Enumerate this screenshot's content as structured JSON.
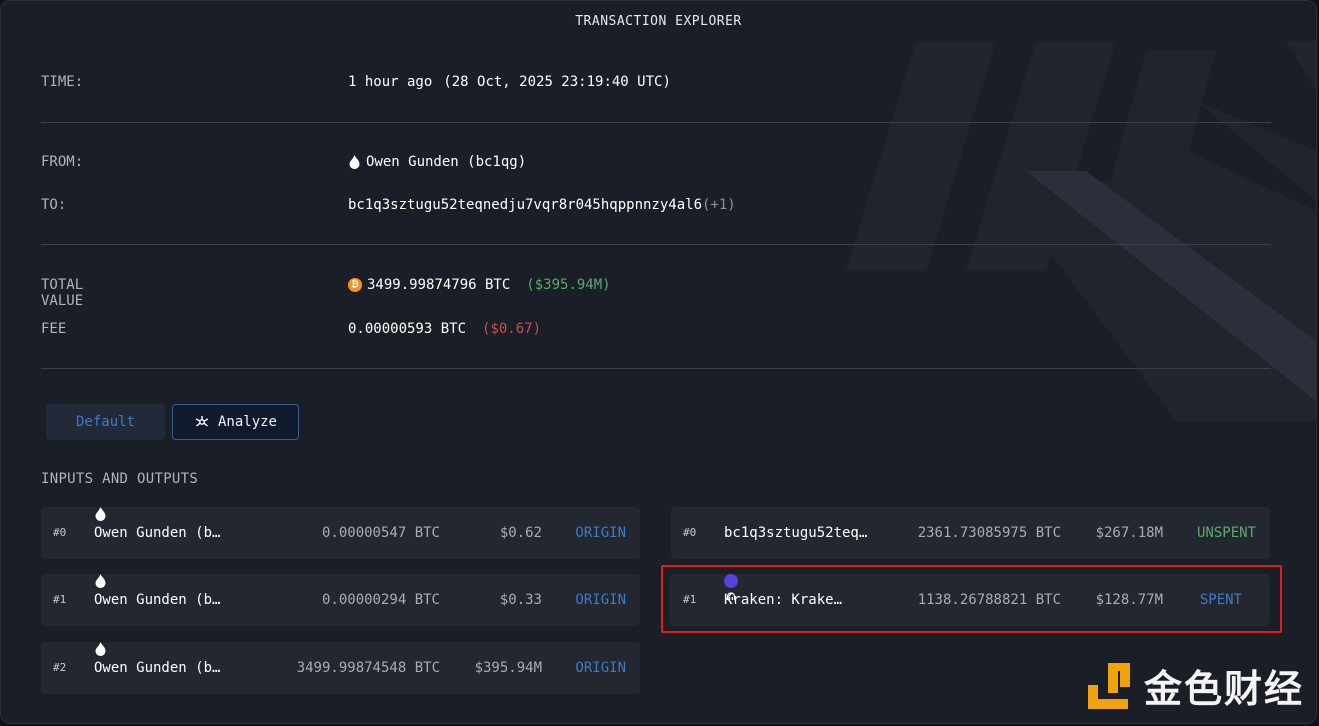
{
  "header": {
    "title": "TRANSACTION EXPLORER"
  },
  "time": {
    "label": "TIME:",
    "value": "1 hour ago",
    "date": "(28 Oct, 2025 23:19:40 UTC)"
  },
  "from": {
    "label": "FROM:",
    "value": "Owen Gunden (bc1qg)"
  },
  "to": {
    "label": "TO:",
    "value": "bc1q3sztugu52teqnedju7vqr8r045hqppnnzy4al6",
    "extra": "(+1)"
  },
  "total": {
    "label": "TOTAL VALUE",
    "btc": "3499.99874796 BTC",
    "usd": "($395.94M)"
  },
  "fee": {
    "label": "FEE",
    "btc": "0.00000593 BTC",
    "usd": "($0.67)"
  },
  "tabs": {
    "default": "Default",
    "analyze": "Analyze"
  },
  "io": {
    "title": "INPUTS AND OUTPUTS",
    "inputs": [
      {
        "idx": "#0",
        "name": "Owen Gunden (b…",
        "amount": "0.00000547 BTC",
        "usd": "$0.62",
        "status": "ORIGIN"
      },
      {
        "idx": "#1",
        "name": "Owen Gunden (b…",
        "amount": "0.00000294 BTC",
        "usd": "$0.33",
        "status": "ORIGIN"
      },
      {
        "idx": "#2",
        "name": "Owen Gunden (b…",
        "amount": "3499.99874548 BTC",
        "usd": "$395.94M",
        "status": "ORIGIN"
      }
    ],
    "outputs": [
      {
        "idx": "#0",
        "name": "bc1q3sztugu52teq…",
        "amount": "2361.73085975 BTC",
        "usd": "$267.18M",
        "status": "UNSPENT"
      },
      {
        "idx": "#1",
        "name": "Kraken: Krake…",
        "amount": "1138.26788821 BTC",
        "usd": "$128.77M",
        "status": "SPENT"
      }
    ]
  },
  "watermark": {
    "text": "金色财经"
  },
  "colors": {
    "accent_blue": "#3f7ac6",
    "green": "#5fa86a",
    "red": "#c1534c",
    "highlight": "#e01e22"
  }
}
